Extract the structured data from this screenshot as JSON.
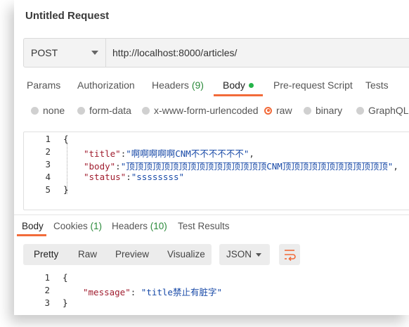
{
  "request": {
    "title": "Untitled Request",
    "method": "POST",
    "url": "http://localhost:8000/articles/"
  },
  "request_tabs": [
    {
      "label": "Params"
    },
    {
      "label": "Authorization"
    },
    {
      "label": "Headers",
      "count": "(9)"
    },
    {
      "label": "Body"
    },
    {
      "label": "Pre-request Script"
    },
    {
      "label": "Tests"
    }
  ],
  "body_modes": [
    {
      "label": "none",
      "selected": false
    },
    {
      "label": "form-data",
      "selected": false
    },
    {
      "label": "x-www-form-urlencoded",
      "selected": false
    },
    {
      "label": "raw",
      "selected": true
    },
    {
      "label": "binary",
      "selected": false
    },
    {
      "label": "GraphQL",
      "selected": false
    }
  ],
  "request_body": {
    "line_numbers": [
      "1",
      "2",
      "3",
      "4",
      "5"
    ],
    "open": "{",
    "close": "}",
    "lines": [
      {
        "key": "\"title\"",
        "value": "\"啊啊啊啊啊CNM不不不不不不\"",
        "end": ","
      },
      {
        "key": "\"body\"",
        "value": "\"顶顶顶顶顶顶顶顶顶顶顶顶顶顶顶顶CNM顶顶顶顶顶顶顶顶顶顶顶顶\"",
        "end": ","
      },
      {
        "key": "\"status\"",
        "value": "\"ssssssss\"",
        "end": ""
      }
    ]
  },
  "response_tabs": [
    {
      "label": "Body"
    },
    {
      "label": "Cookies",
      "count": "(1)"
    },
    {
      "label": "Headers",
      "count": "(10)"
    },
    {
      "label": "Test Results"
    }
  ],
  "response_view": {
    "modes": [
      "Pretty",
      "Raw",
      "Preview",
      "Visualize"
    ],
    "format": "JSON"
  },
  "response_body": {
    "line_numbers": [
      "1",
      "2",
      "3"
    ],
    "open": "{",
    "close": "}",
    "key": "\"message\"",
    "value": "\"title禁止有脏字\""
  },
  "colors": {
    "accent": "#f26b3a",
    "count_green": "#2a8a3a",
    "json_key": "#a01d2f",
    "json_string": "#1a4ba8"
  }
}
